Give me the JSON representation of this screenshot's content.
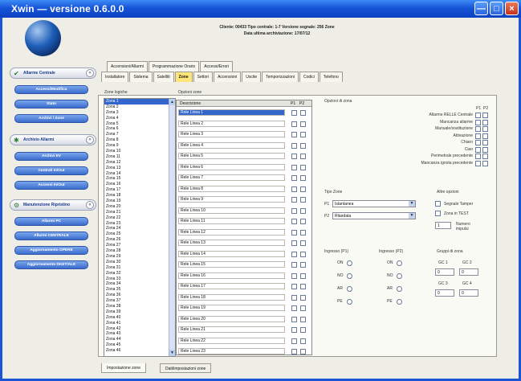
{
  "window": {
    "title": "Xwin  —  versione 0.6.0.0",
    "minimize_label": "—",
    "maximize_label": "□",
    "close_label": "×"
  },
  "header": {
    "line1": "Cliente: 00433 Tipo centrale: 1-7 Versione segnale: 256 Zone",
    "line2": "Data ultima archiviazione: 17/07/12"
  },
  "sidebar": {
    "sections": [
      {
        "label": "Allarme Centrale",
        "icon": "shield-icon",
        "chev": "«",
        "buttons": [
          "Accessi/Modifica",
          "Stato",
          "Archivi / Zone"
        ]
      },
      {
        "label": "Archivio Allarmi",
        "icon": "archive-icon",
        "chev": "«",
        "buttons": [
          "Archivi EV",
          "Centrali In/Out",
          "Accessi In/Out"
        ]
      },
      {
        "label": "Manutenzione Ripristino",
        "icon": "wrench-icon",
        "chev": "«",
        "buttons": [
          "Allarmi PC",
          "Allarmi CENTRALE",
          "Aggiornamento OPERE",
          "Aggiornamento DIGIT/ALE"
        ]
      }
    ]
  },
  "tabs_row1": [
    "Accensioni/Allarmi",
    "Programmazione Orario",
    "Accessi/Errori"
  ],
  "tabs_row2": [
    "Installatore",
    "Sistema",
    "Satelliti",
    "Zone",
    "Settori",
    "Accensioni",
    "Uscite",
    "Temporizzazioni",
    "Codici",
    "Telefono"
  ],
  "active_tab_index": 3,
  "left_list": {
    "header": "Zone logiche",
    "items": [
      "Zona 1",
      "Zona 2",
      "Zona 3",
      "Zona 4",
      "Zona 5",
      "Zona 6",
      "Zona 7",
      "Zona 8",
      "Zona 9",
      "Zona 10",
      "Zona 11",
      "Zona 12",
      "Zona 13",
      "Zona 14",
      "Zona 15",
      "Zona 16",
      "Zona 17",
      "Zona 18",
      "Zona 19",
      "Zona 20",
      "Zona 21",
      "Zona 22",
      "Zona 23",
      "Zona 24",
      "Zona 25",
      "Zona 26",
      "Zona 27",
      "Zona 28",
      "Zona 29",
      "Zona 30",
      "Zona 31",
      "Zona 32",
      "Zona 33",
      "Zona 34",
      "Zona 35",
      "Zona 36",
      "Zona 37",
      "Zona 38",
      "Zona 39",
      "Zona 40",
      "Zona 41",
      "Zona 42",
      "Zona 43",
      "Zona 44",
      "Zona 45",
      "Zona 46"
    ],
    "selected_index": 0,
    "scroll_up": "▲",
    "scroll_down": "▼"
  },
  "grid": {
    "header": "Opzioni zone",
    "col_desc": "Descrizione",
    "col_p1": "P1",
    "col_p2": "P2",
    "rows": [
      "Rele Linea 1",
      "Rele Linea 2",
      "Rele Linea 3",
      "Rele Linea 4",
      "Rele Linea 5",
      "Rele Linea 6",
      "Rele Linea 7",
      "Rele Linea 8",
      "Rele Linea 9",
      "Rele Linea 10",
      "Rele Linea 11",
      "Rele Linea 12",
      "Rele Linea 13",
      "Rele Linea 14",
      "Rele Linea 15",
      "Rele Linea 16",
      "Rele Linea 17",
      "Rele Linea 18",
      "Rele Linea 19",
      "Rele Linea 20",
      "Rele Linea 21",
      "Rele Linea 22",
      "Rele Linea 23"
    ],
    "selected_index": 0
  },
  "right_panel": {
    "group_title": "Opzioni di zona",
    "p1_label": "P1",
    "p2_label": "P2",
    "checks": [
      "Allarme RELLE Centrale",
      "Mancanza allarme",
      "Manuale/sostituzione",
      "Attivazione",
      "Chiaro",
      "Ciao",
      "Perimetrale precedente",
      "Mancanza ignota precedente"
    ],
    "tipo_label": "Tipo Zone",
    "p1_prefix": "P1",
    "p2_prefix": "P2",
    "p1_value": "Istantanea",
    "p2_value": "Ritardata",
    "altre_label": "Altre opzioni",
    "altre_checks": [
      "Segnale Tamper",
      "Zona in TEST"
    ],
    "numero_value": "1",
    "numero_label": "Numero impulsi",
    "ingr_p1_label": "Ingresso (P1)",
    "ingr_p2_label": "Ingresso (P2)",
    "radio_labels": [
      "ON",
      "NO",
      "AR",
      "PE"
    ],
    "gruppo_label": "Gruppi di zona",
    "gruppo_fields": [
      {
        "label": "GC 1",
        "value": "0"
      },
      {
        "label": "GC 2",
        "value": "0"
      },
      {
        "label": "GC 3",
        "value": "0"
      },
      {
        "label": "GC 4",
        "value": "0"
      }
    ]
  },
  "bottom_tabs": [
    "Impostazione zone",
    "Dati/impostazioni zone"
  ]
}
